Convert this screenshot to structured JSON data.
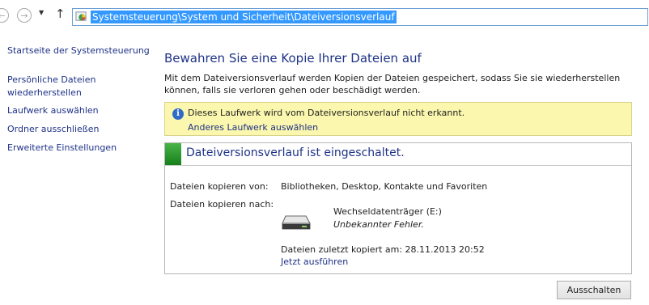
{
  "address_bar": {
    "path": "Systemsteuerung\\System und Sicherheit\\Dateiversionsverlauf",
    "back_icon": "back-arrow-icon",
    "forward_icon": "forward-arrow-icon",
    "recent_icon": "chevron-down-icon",
    "up_icon": "up-arrow-icon",
    "location_icon": "control-panel-icon"
  },
  "sidebar": {
    "items": [
      {
        "label": "Startseite der Systemsteuerung"
      },
      {
        "label": "Persönliche Dateien wiederherstellen"
      },
      {
        "label": "Laufwerk auswählen"
      },
      {
        "label": "Ordner ausschließen"
      },
      {
        "label": "Erweiterte Einstellungen"
      }
    ]
  },
  "main": {
    "title": "Bewahren Sie eine Kopie Ihrer Dateien auf",
    "intro": "Mit dem Dateiversionsverlauf werden Kopien der Dateien gespeichert, sodass Sie sie wiederherstellen können, falls sie verloren gehen oder beschädigt werden.",
    "warning": {
      "text": "Dieses Laufwerk wird vom Dateiversionsverlauf nicht erkannt.",
      "link": "Anderes Laufwerk auswählen",
      "icon": "info-icon"
    },
    "status": {
      "title": "Dateiversionsverlauf ist eingeschaltet.",
      "copy_from_label": "Dateien kopieren von:",
      "copy_from_value": "Bibliotheken, Desktop, Kontakte und Favoriten",
      "copy_to_label": "Dateien kopieren nach:",
      "drive_name": "Wechseldatenträger (E:)",
      "drive_error": "Unbekannter Fehler.",
      "drive_icon": "removable-drive-icon",
      "last_copied": "Dateien zuletzt kopiert am: 28.11.2013 20:52",
      "run_link": "Jetzt ausführen",
      "accent_color": "#2e9b34"
    },
    "off_button": "Ausschalten"
  }
}
